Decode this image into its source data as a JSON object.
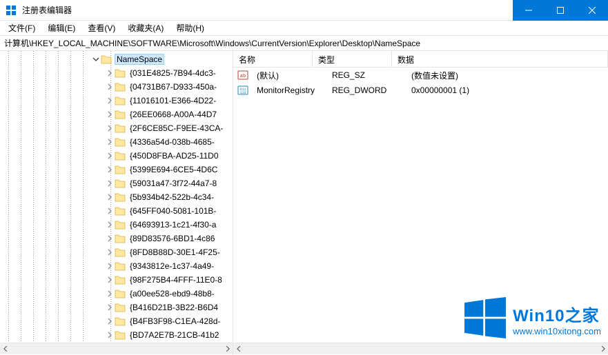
{
  "window": {
    "title": "注册表编辑器"
  },
  "menu": {
    "file": "文件(F)",
    "edit": "编辑(E)",
    "view": "查看(V)",
    "favorites": "收藏夹(A)",
    "help": "帮助(H)"
  },
  "address": {
    "path": "计算机\\HKEY_LOCAL_MACHINE\\SOFTWARE\\Microsoft\\Windows\\CurrentVersion\\Explorer\\Desktop\\NameSpace"
  },
  "tree": {
    "selected": "NameSpace",
    "items": [
      "{031E4825-7B94-4dc3-",
      "{04731B67-D933-450a-",
      "{11016101-E366-4D22-",
      "{26EE0668-A00A-44D7",
      "{2F6CE85C-F9EE-43CA-",
      "{4336a54d-038b-4685-",
      "{450D8FBA-AD25-11D0",
      "{5399E694-6CE5-4D6C",
      "{59031a47-3f72-44a7-8",
      "{5b934b42-522b-4c34-",
      "{645FF040-5081-101B-",
      "{64693913-1c21-4f30-a",
      "{89D83576-6BD1-4c86",
      "{8FD8B88D-30E1-4F25-",
      "{9343812e-1c37-4a49-",
      "{98F275B4-4FFF-11E0-8",
      "{a00ee528-ebd9-48b8-",
      "{B416D21B-3B22-B6D4",
      "{B4FB3F98-C1EA-428d-",
      "{BD7A2E7B-21CB-41b2"
    ]
  },
  "list": {
    "columns": {
      "name": "名称",
      "type": "类型",
      "data": "数据"
    },
    "rows": [
      {
        "icon": "string",
        "name": "(默认)",
        "type": "REG_SZ",
        "data": "(数值未设置)"
      },
      {
        "icon": "binary",
        "name": "MonitorRegistry",
        "type": "REG_DWORD",
        "data": "0x00000001 (1)"
      }
    ]
  },
  "watermark": {
    "brand": "Win10之家",
    "url": "www.win10xitong.com"
  }
}
